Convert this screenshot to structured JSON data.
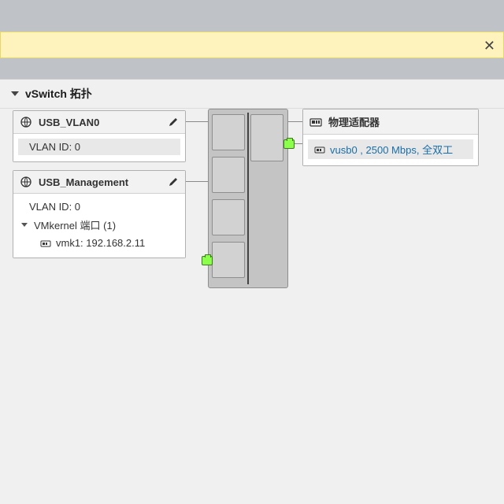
{
  "notification": {},
  "panel": {
    "title": "vSwitch 拓扑"
  },
  "portgroups": [
    {
      "name": "USB_VLAN0",
      "vlan_label": "VLAN ID: 0"
    },
    {
      "name": "USB_Management",
      "vlan_label": "VLAN ID: 0",
      "vmk_section": "VMkernel 端口 (1)",
      "vmk_entry": "vmk1: 192.168.2.11"
    }
  ],
  "physical": {
    "title": "物理适配器",
    "adapter_text": "vusb0 , 2500 Mbps, 全双工"
  }
}
